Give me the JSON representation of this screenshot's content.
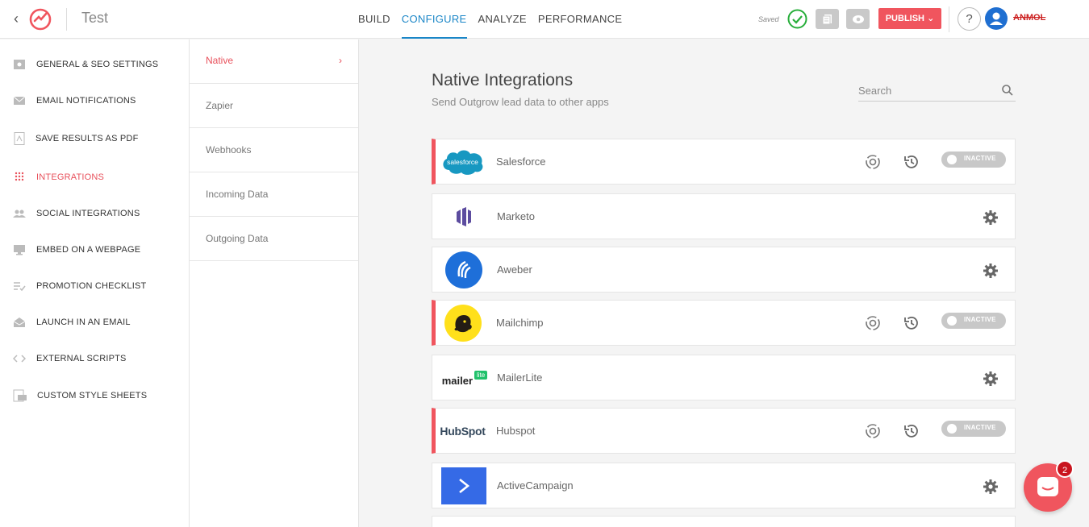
{
  "app": {
    "title": "Test",
    "saved_label": "Saved",
    "publish_label": "PUBLISH",
    "user_name": "ANMOL",
    "help_label": "?"
  },
  "nav": {
    "tabs": [
      "BUILD",
      "CONFIGURE",
      "ANALYZE",
      "PERFORMANCE"
    ],
    "active": "CONFIGURE"
  },
  "sidebar": {
    "items": [
      {
        "label": "GENERAL & SEO SETTINGS",
        "icon": "settings-icon"
      },
      {
        "label": "EMAIL NOTIFICATIONS",
        "icon": "mail-icon"
      },
      {
        "label": "SAVE RESULTS AS PDF",
        "icon": "pdf-icon"
      },
      {
        "label": "INTEGRATIONS",
        "icon": "integrations-icon"
      },
      {
        "label": "SOCIAL INTEGRATIONS",
        "icon": "users-icon"
      },
      {
        "label": "EMBED ON A WEBPAGE",
        "icon": "monitor-icon"
      },
      {
        "label": "PROMOTION CHECKLIST",
        "icon": "checklist-icon"
      },
      {
        "label": "LAUNCH IN AN EMAIL",
        "icon": "envelope-open-icon"
      },
      {
        "label": "EXTERNAL SCRIPTS",
        "icon": "code-icon"
      },
      {
        "label": "CUSTOM STYLE SHEETS",
        "icon": "css-icon"
      }
    ],
    "active": "INTEGRATIONS"
  },
  "subnav": {
    "items": [
      "Native",
      "Zapier",
      "Webhooks",
      "Incoming Data",
      "Outgoing Data"
    ],
    "active": "Native",
    "chevron": "›"
  },
  "main": {
    "title": "Native Integrations",
    "subtitle": "Send Outgrow lead data to other apps",
    "search_placeholder": "Search",
    "integrations": [
      {
        "name": "Salesforce",
        "logo_text": "salesforce",
        "status": "INACTIVE",
        "configured": true
      },
      {
        "name": "Marketo",
        "configured": false
      },
      {
        "name": "Aweber",
        "configured": false
      },
      {
        "name": "Mailchimp",
        "status": "INACTIVE",
        "configured": true
      },
      {
        "name": "MailerLite",
        "logo_text": "mailer",
        "logo_badge": "lite",
        "configured": false
      },
      {
        "name": "Hubspot",
        "logo_text": "HubSpot",
        "status": "INACTIVE",
        "configured": true
      },
      {
        "name": "ActiveCampaign",
        "configured": false
      }
    ]
  },
  "chat": {
    "badge_count": "2"
  },
  "colors": {
    "accent_red": "#f0555e",
    "accent_blue": "#1a86c7",
    "green_check": "#27ae3a"
  }
}
